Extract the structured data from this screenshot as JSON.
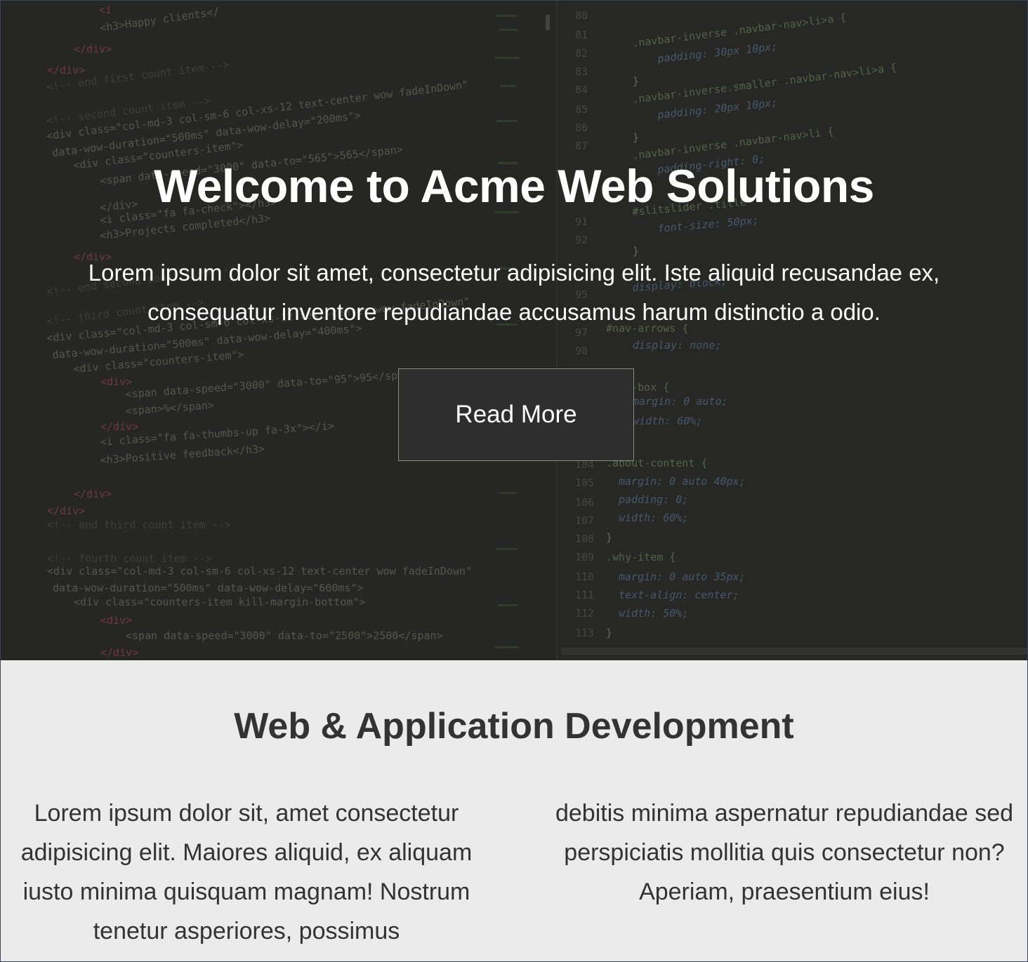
{
  "hero": {
    "title": "Welcome to Acme Web Solutions",
    "text": "Lorem ipsum dolor sit amet, consectetur adipisicing elit. Iste aliquid recusandae ex, consequatur inventore repudiandae accusamus harum distinctio a odio.",
    "button_label": "Read More",
    "background_image": "code-editor-screenshot"
  },
  "services": {
    "title": "Web & Application Development",
    "col_left": "Lorem ipsum dolor sit, amet consectetur adipisicing elit. Maiores aliquid, ex aliquam iusto minima quisquam magnam! Nostrum tenetur asperiores, possimus",
    "col_right": "debitis minima aspernatur repudiandae sed perspiciatis mollitia quis consectetur non? Aperiam, praesentium eius!"
  },
  "colors": {
    "hero_bg": "#2a2a29",
    "section_bg": "#ebebeb",
    "text_dark": "#333333",
    "button_bg": "#2e2e2f"
  }
}
